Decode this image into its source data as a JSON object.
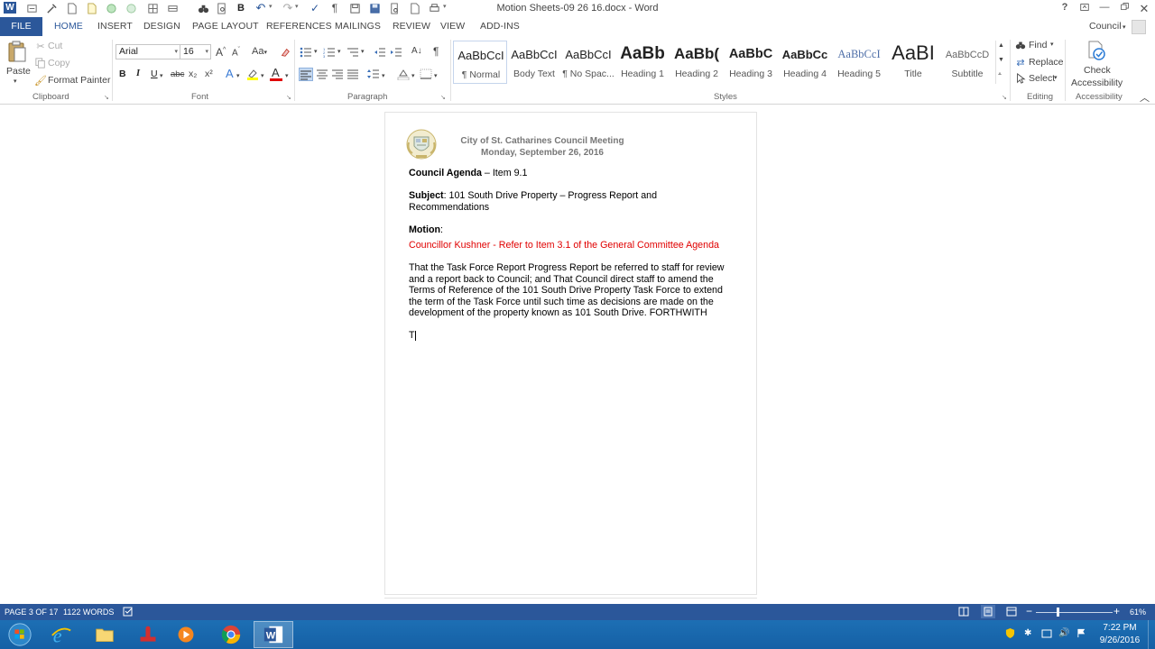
{
  "window": {
    "title": "Motion Sheets-09 26 16.docx - Word",
    "help": "?",
    "account": "Council"
  },
  "tabs": {
    "file": "FILE",
    "items": [
      "HOME",
      "INSERT",
      "DESIGN",
      "PAGE LAYOUT",
      "REFERENCES",
      "MAILINGS",
      "REVIEW",
      "VIEW",
      "ADD-INS"
    ]
  },
  "ribbon": {
    "clipboard": {
      "paste": "Paste",
      "cut": "Cut",
      "copy": "Copy",
      "format_painter": "Format Painter",
      "label": "Clipboard"
    },
    "font": {
      "name": "Arial",
      "size": "16",
      "label": "Font",
      "grow": "A",
      "shrink": "A",
      "change_case": "Aa",
      "bold": "B",
      "italic": "I",
      "underline": "U",
      "strike": "abc",
      "subscript": "x₂",
      "superscript": "x²",
      "effects": "A",
      "font_color": "A",
      "font_color_value": "#e00000",
      "highlight_color_value": "#ffff00"
    },
    "paragraph": {
      "label": "Paragraph"
    },
    "styles": {
      "label": "Styles",
      "items": [
        {
          "preview": "AaBbCcI",
          "name": "¶ Normal"
        },
        {
          "preview": "AaBbCcI",
          "name": "Body Text"
        },
        {
          "preview": "AaBbCcI",
          "name": "¶ No Spac..."
        },
        {
          "preview": "AaBb",
          "name": "Heading 1"
        },
        {
          "preview": "AaBb(",
          "name": "Heading 2"
        },
        {
          "preview": "AaBbC",
          "name": "Heading 3"
        },
        {
          "preview": "AaBbCc",
          "name": "Heading 4"
        },
        {
          "preview": "AaBbCcI",
          "name": "Heading 5"
        },
        {
          "preview": "AaBI",
          "name": "Title"
        },
        {
          "preview": "AaBbCcD",
          "name": "Subtitle"
        }
      ]
    },
    "editing": {
      "find": "Find",
      "replace": "Replace",
      "select": "Select",
      "label": "Editing"
    },
    "accessibility": {
      "check_line1": "Check",
      "check_line2": "Accessibility",
      "label": "Accessibility"
    }
  },
  "document": {
    "header_line1": "City of St. Catharines Council Meeting",
    "header_line2": "Monday, September 26, 2016",
    "agenda_label": "Council Agenda",
    "agenda_rest": " – Item 9.1",
    "subject_label": "Subject",
    "subject_line1": ": 101 South Drive Property – Progress Report and",
    "subject_line2": "Recommendations",
    "motion_label": "Motion",
    "motion_rest": ":",
    "councillor_line": "Councillor Kushner - Refer to Item 3.1 of the General Committee Agenda",
    "body_lines": [
      "That the Task Force Report Progress Report be referred to staff for review",
      "and a report back to Council; and That Council direct staff to amend the",
      "Terms of Reference of the 101 South Drive Property Task Force to extend",
      "the term of the Task Force until such time as decisions are made on the",
      "development of the property known as 101 South Drive. FORTHWITH"
    ],
    "cursor_text": "T",
    "accent_red": "#e00000"
  },
  "status": {
    "page": "PAGE 3 OF 17",
    "words": "1122 WORDS",
    "zoom_minus": "−",
    "zoom_plus": "+",
    "zoom": "61%",
    "zoom_level": 0.61
  },
  "taskbar": {
    "time": "7:22 PM",
    "date": "9/26/2016"
  },
  "colors": {
    "word_blue": "#2b579a",
    "taskbar": "#1560a5"
  }
}
